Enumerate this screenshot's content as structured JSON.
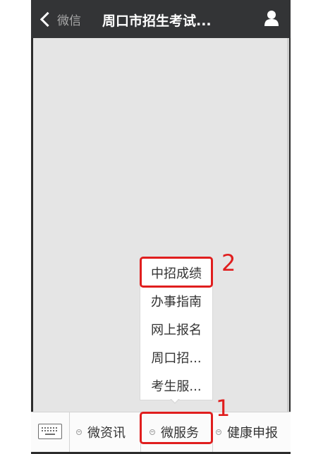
{
  "titlebar": {
    "back_label": "微信",
    "title": "周口市招生考试..."
  },
  "bottom_menu": {
    "items": [
      {
        "label": "微资讯"
      },
      {
        "label": "微服务"
      },
      {
        "label": "健康申报"
      }
    ]
  },
  "popup_menu": {
    "items": [
      {
        "label": "中招成绩"
      },
      {
        "label": "办事指南"
      },
      {
        "label": "网上报名"
      },
      {
        "label": "周口招..."
      },
      {
        "label": "考生服..."
      }
    ]
  },
  "annotations": {
    "step1": "1",
    "step2": "2",
    "color": "#e01e1e"
  },
  "icons": {
    "back": "chevron-left-icon",
    "profile": "person-icon",
    "keyboard": "keyboard-icon"
  }
}
